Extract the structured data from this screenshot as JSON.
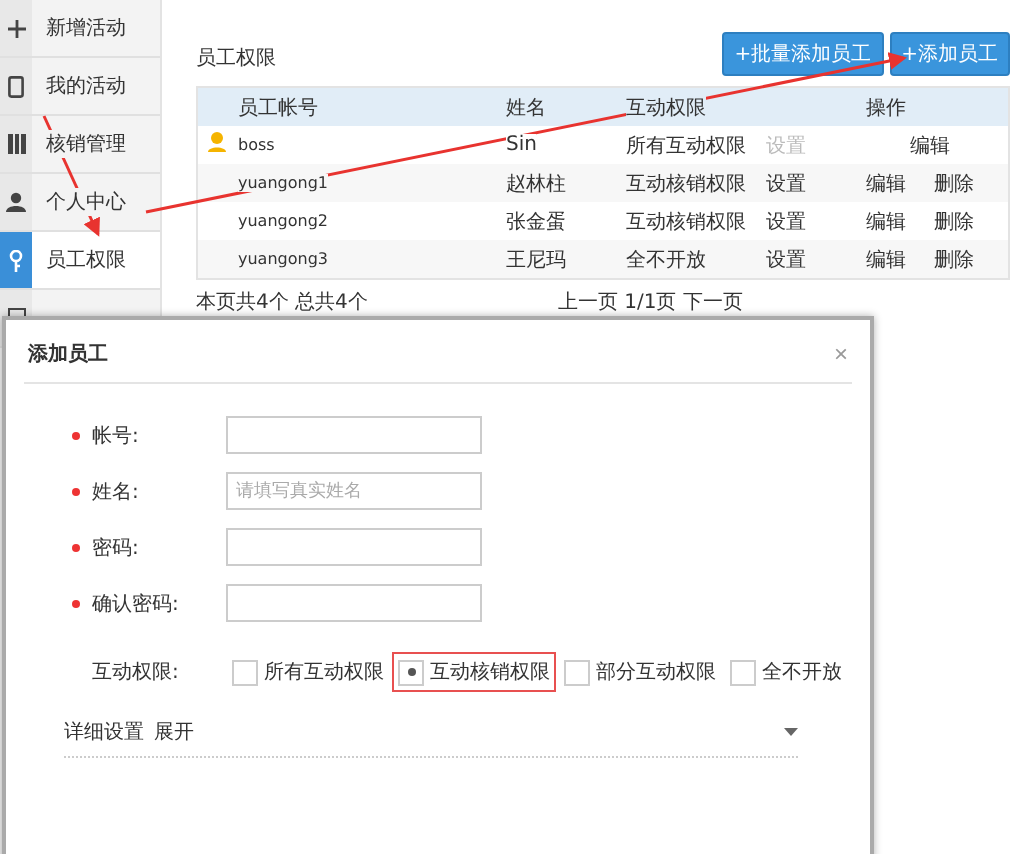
{
  "sidebar": {
    "items": [
      {
        "label": "新增活动",
        "selected": false
      },
      {
        "label": "我的活动",
        "selected": false
      },
      {
        "label": "核销管理",
        "selected": false
      },
      {
        "label": "个人中心",
        "selected": false
      },
      {
        "label": "员工权限",
        "selected": true
      },
      {
        "selected": false
      }
    ]
  },
  "page_title": "员工权限",
  "buttons": [
    "+批量添加员工",
    "+添加员工"
  ],
  "table": {
    "columns": [
      "员工帐号",
      "姓名",
      "互动权限",
      "",
      "操作"
    ],
    "rows": [
      {
        "owner": true,
        "account": "boss",
        "name": "Sin",
        "permission": "所有互动权限",
        "setting": "设置",
        "setting_disabled": true,
        "actions": [
          "编辑"
        ]
      },
      {
        "owner": false,
        "account": "yuangong1",
        "name": "赵林柱",
        "permission": "互动核销权限",
        "setting": "设置",
        "setting_disabled": false,
        "actions": [
          "编辑",
          "删除"
        ]
      },
      {
        "owner": false,
        "account": "yuangong2",
        "name": "张金蛋",
        "permission": "互动核销权限",
        "setting": "设置",
        "setting_disabled": false,
        "actions": [
          "编辑",
          "删除"
        ]
      },
      {
        "owner": false,
        "account": "yuangong3",
        "name": "王尼玛",
        "permission": "全不开放",
        "setting": "设置",
        "setting_disabled": false,
        "actions": [
          "编辑",
          "删除"
        ]
      }
    ]
  },
  "footer": {
    "summary": "本页共4个 总共4个",
    "pagination": "上一页 1/1页 下一页"
  },
  "dialog": {
    "title": "添加员工",
    "close": "×",
    "fields": [
      {
        "label": "帐号:",
        "required": true
      },
      {
        "label": "姓名:",
        "required": true,
        "placeholder": "请填写真实姓名"
      },
      {
        "label": "密码:",
        "required": true
      },
      {
        "label": "确认密码:",
        "required": true
      }
    ],
    "permission": {
      "label": "互动权限:",
      "options": [
        {
          "label": "所有互动权限",
          "selected": false
        },
        {
          "label": "互动核销权限",
          "selected": true
        },
        {
          "label": "部分互动权限",
          "selected": false
        },
        {
          "label": "全不开放",
          "selected": false
        }
      ]
    },
    "details": {
      "label": "详细设置",
      "toggle": "展开"
    }
  }
}
